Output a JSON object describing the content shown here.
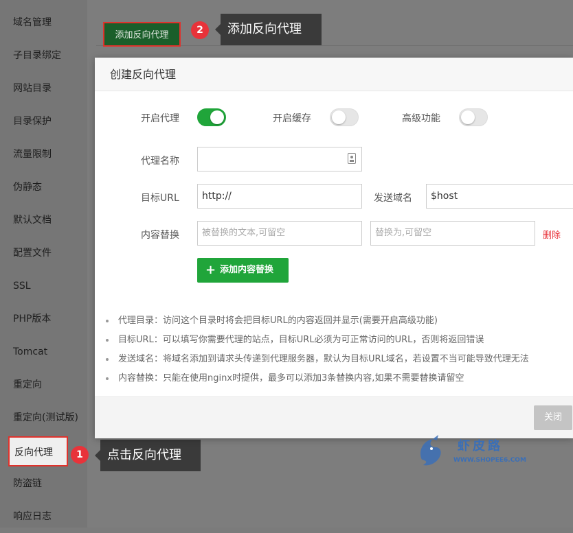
{
  "sidebar": {
    "items": [
      {
        "label": "域名管理"
      },
      {
        "label": "子目录绑定"
      },
      {
        "label": "网站目录"
      },
      {
        "label": "目录保护"
      },
      {
        "label": "流量限制"
      },
      {
        "label": "伪静态"
      },
      {
        "label": "默认文档"
      },
      {
        "label": "配置文件"
      },
      {
        "label": "SSL"
      },
      {
        "label": "PHP版本"
      },
      {
        "label": "Tomcat"
      },
      {
        "label": "重定向"
      },
      {
        "label": "重定向(测试版)"
      },
      {
        "label": "反向代理"
      },
      {
        "label": "防盗链"
      },
      {
        "label": "响应日志"
      }
    ]
  },
  "toolbar": {
    "add_proxy_label": "添加反向代理"
  },
  "annotations": {
    "step1_number": "1",
    "step1_text": "点击反向代理",
    "step2_number": "2",
    "step2_text": "添加反向代理"
  },
  "modal": {
    "title": "创建反向代理",
    "toggles": {
      "enable_proxy_label": "开启代理",
      "enable_proxy_on": true,
      "enable_cache_label": "开启缓存",
      "enable_cache_on": false,
      "advanced_label": "高级功能",
      "advanced_on": false
    },
    "proxy_name_label": "代理名称",
    "proxy_name_value": "",
    "target_url_label": "目标URL",
    "target_url_value": "http://",
    "send_domain_label": "发送域名",
    "send_domain_value": "$host",
    "content_replace_label": "内容替换",
    "replace_from_placeholder": "被替换的文本,可留空",
    "replace_to_placeholder": "替换为,可留空",
    "delete_label": "删除",
    "add_replace_label": "添加内容替换",
    "notes": [
      "代理目录：访问这个目录时将会把目标URL的内容返回并显示(需要开启高级功能)",
      "目标URL：可以填写你需要代理的站点，目标URL必须为可正常访问的URL，否则将返回错误",
      "发送域名：将域名添加到请求头传递到代理服务器，默认为目标URL域名，若设置不当可能导致代理无法",
      "内容替换：只能在使用nginx时提供，最多可以添加3条替换内容,如果不需要替换请留空"
    ],
    "close_label": "关闭"
  },
  "watermark": {
    "name": "虾皮路",
    "url": "WWW.SHOPEE6.COM"
  },
  "colors": {
    "accent_green": "#20a53a",
    "annotation_red": "#e8333a",
    "tooltip_bg": "#3a3a3a"
  }
}
